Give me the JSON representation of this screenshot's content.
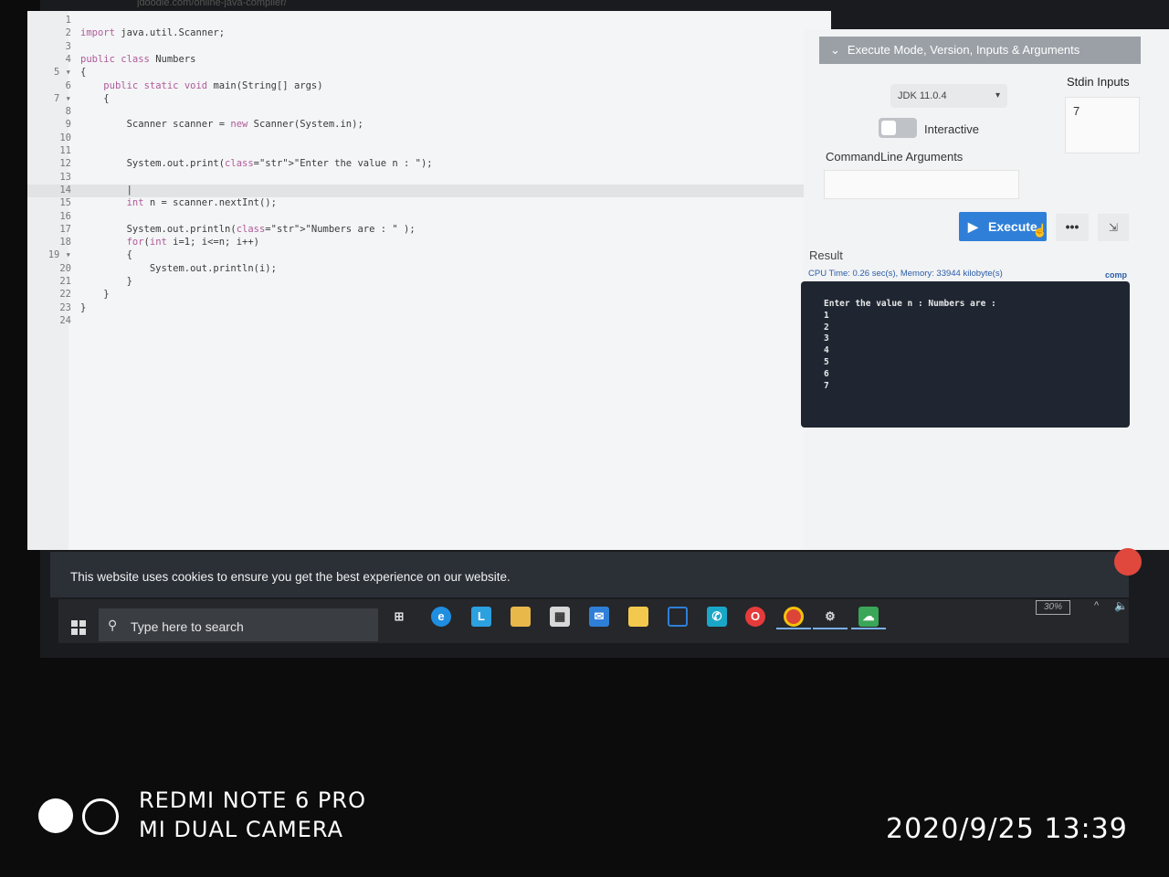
{
  "browser": {
    "url_fragment": "jdoodle.com/online-java-compiler/"
  },
  "editor": {
    "lines": [
      {
        "n": "1",
        "code": ""
      },
      {
        "n": "2",
        "code": "import java.util.Scanner;"
      },
      {
        "n": "3",
        "code": ""
      },
      {
        "n": "4",
        "code": "public class Numbers"
      },
      {
        "n": "5 ▾",
        "code": "{"
      },
      {
        "n": "6",
        "code": "    public static void main(String[] args)"
      },
      {
        "n": "7 ▾",
        "code": "    {"
      },
      {
        "n": "8",
        "code": ""
      },
      {
        "n": "9",
        "code": "        Scanner scanner = new Scanner(System.in);"
      },
      {
        "n": "10",
        "code": ""
      },
      {
        "n": "11",
        "code": ""
      },
      {
        "n": "12",
        "code": "        System.out.print(\"Enter the value n : \");"
      },
      {
        "n": "13",
        "code": ""
      },
      {
        "n": "14",
        "code": "        |"
      },
      {
        "n": "15",
        "code": "        int n = scanner.nextInt();"
      },
      {
        "n": "16",
        "code": ""
      },
      {
        "n": "17",
        "code": "        System.out.println(\"Numbers are : \" );"
      },
      {
        "n": "18",
        "code": "        for(int i=1; i<=n; i++)"
      },
      {
        "n": "19 ▾",
        "code": "        {"
      },
      {
        "n": "20",
        "code": "            System.out.println(i);"
      },
      {
        "n": "21",
        "code": "        }"
      },
      {
        "n": "22",
        "code": "    }"
      },
      {
        "n": "23",
        "code": "}"
      },
      {
        "n": "24",
        "code": ""
      }
    ]
  },
  "panel": {
    "header": "Execute Mode, Version, Inputs & Arguments",
    "header_icon": "chevron-down-icon",
    "jdk_version": "JDK 11.0.4",
    "interactive_label": "Interactive",
    "cmd_label": "CommandLine Arguments",
    "stdin_label": "Stdin Inputs",
    "stdin_value": "7",
    "execute_label": "Execute",
    "more_label": "•••",
    "shrink_label": "⇲",
    "result_label": "Result",
    "cpu_text": "CPU Time: 0.26 sec(s), Memory: 33944 kilobyte(s)",
    "comp_text": "comp",
    "output": [
      "Enter the value n : Numbers are :",
      "1",
      "2",
      "3",
      "4",
      "5",
      "6",
      "7"
    ],
    "accent_color": "#2f7fd8"
  },
  "cookie": {
    "text": "This website uses cookies to ensure you get the best experience on our website."
  },
  "taskbar": {
    "search_placeholder": "Type here to search",
    "battery": "30%",
    "icons": [
      "windows-icon",
      "task-view-icon",
      "edge-icon",
      "l-app-icon",
      "file-explorer-icon",
      "store-icon",
      "mail-icon",
      "sticky-notes-icon",
      "window-app-icon",
      "whatsapp-icon",
      "opera-icon",
      "chrome-icon",
      "settings-icon",
      "cloud-icon"
    ]
  },
  "watermark": {
    "line1": "REDMI NOTE 6 PRO",
    "line2": "MI DUAL CAMERA",
    "datetime": "2020/9/25  13:39"
  }
}
